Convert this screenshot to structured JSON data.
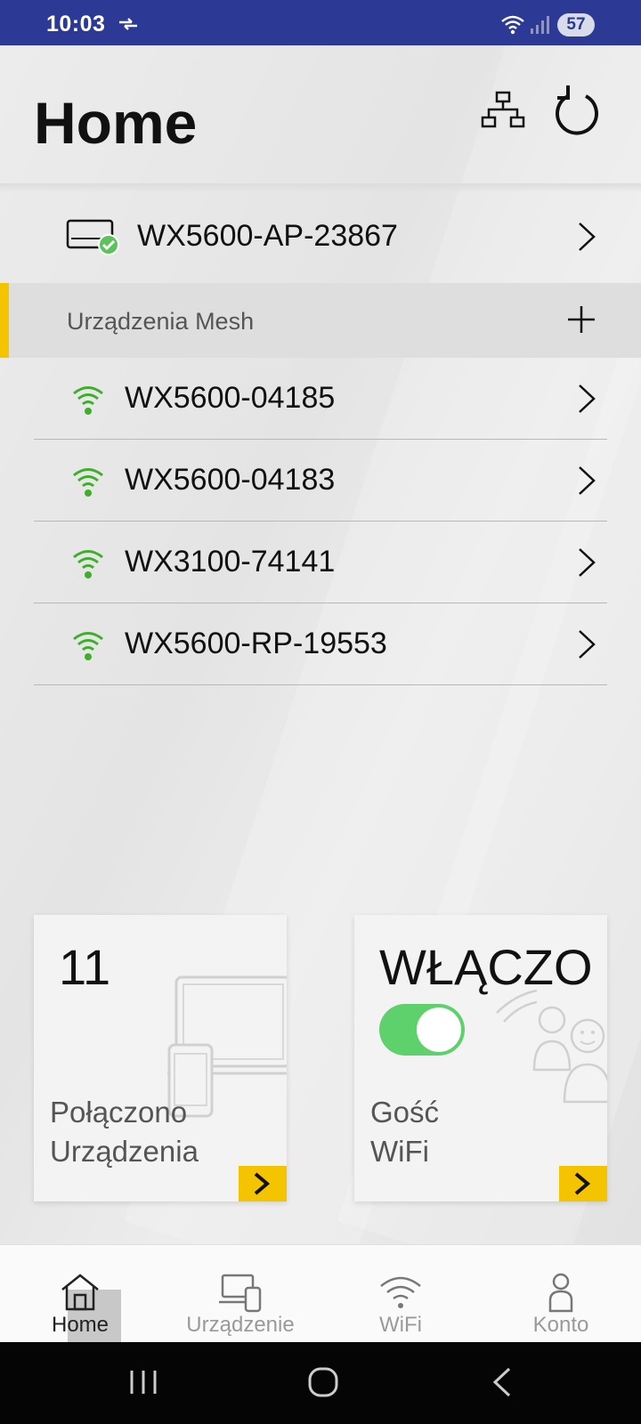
{
  "status_bar": {
    "time": "10:03",
    "battery": "57"
  },
  "header": {
    "title": "Home",
    "topology_icon": "network-topology-icon",
    "refresh_icon": "refresh-icon"
  },
  "ap": {
    "name": "WX5600-AP-23867",
    "icon": "router-connected-icon"
  },
  "mesh": {
    "section_label": "Urządzenia Mesh",
    "items": [
      {
        "name": "WX5600-04185"
      },
      {
        "name": "WX5600-04183"
      },
      {
        "name": "WX3100-74141"
      },
      {
        "name": "WX5600-RP-19553"
      }
    ]
  },
  "cards": {
    "devices": {
      "count": "11",
      "line1": "Połączono",
      "line2": "Urządzenia"
    },
    "guest": {
      "state": "WŁĄCZO",
      "line1": "Gość",
      "line2": "WiFi",
      "toggle_on": true
    }
  },
  "bottom_nav": {
    "items": [
      {
        "label": "Home",
        "icon": "home-icon",
        "active": true
      },
      {
        "label": "Urządzenie",
        "icon": "devices-icon",
        "active": false
      },
      {
        "label": "WiFi",
        "icon": "wifi-icon",
        "active": false
      },
      {
        "label": "Konto",
        "icon": "account-icon",
        "active": false
      }
    ]
  },
  "colors": {
    "status_bar": "#2c3a96",
    "accent": "#f5c400",
    "signal_green": "#3fae2a",
    "toggle_on": "#5ed16c"
  }
}
